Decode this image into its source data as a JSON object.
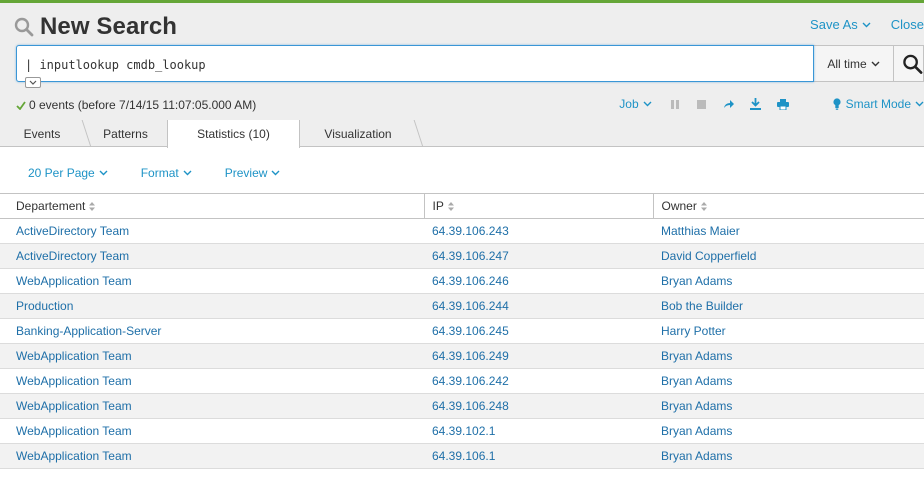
{
  "header": {
    "title": "New Search",
    "save_as": "Save As",
    "close": "Close"
  },
  "search": {
    "query": "| inputlookup cmdb_lookup",
    "time_range": "All time"
  },
  "status": {
    "text": "0 events (before 7/14/15 11:07:05.000 AM)"
  },
  "job": {
    "label": "Job",
    "mode": "Smart Mode"
  },
  "tabs": [
    {
      "label": "Events"
    },
    {
      "label": "Patterns"
    },
    {
      "label": "Statistics (10)"
    },
    {
      "label": "Visualization"
    }
  ],
  "controls": {
    "per_page": "20 Per Page",
    "format": "Format",
    "preview": "Preview"
  },
  "table": {
    "columns": [
      "Departement",
      "IP",
      "Owner"
    ],
    "rows": [
      [
        "ActiveDirectory Team",
        "64.39.106.243",
        "Matthias Maier"
      ],
      [
        "ActiveDirectory Team",
        "64.39.106.247",
        "David Copperfield"
      ],
      [
        "WebApplication Team",
        "64.39.106.246",
        "Bryan Adams"
      ],
      [
        "Production",
        "64.39.106.244",
        "Bob the Builder"
      ],
      [
        "Banking-Application-Server",
        "64.39.106.245",
        "Harry Potter"
      ],
      [
        "WebApplication Team",
        "64.39.106.249",
        "Bryan Adams"
      ],
      [
        "WebApplication Team",
        "64.39.106.242",
        "Bryan Adams"
      ],
      [
        "WebApplication Team",
        "64.39.106.248",
        "Bryan Adams"
      ],
      [
        "WebApplication Team",
        "64.39.102.1",
        "Bryan Adams"
      ],
      [
        "WebApplication Team",
        "64.39.106.1",
        "Bryan Adams"
      ]
    ]
  },
  "colors": {
    "accent": "#65a637",
    "link": "#1e93c6",
    "cell_link": "#1e6fa8",
    "focus_border": "#3a96d6"
  },
  "icons": {
    "title": "search-icon",
    "search_button": "search-icon",
    "status": "checkmark-icon",
    "mode": "lightbulb-icon"
  }
}
